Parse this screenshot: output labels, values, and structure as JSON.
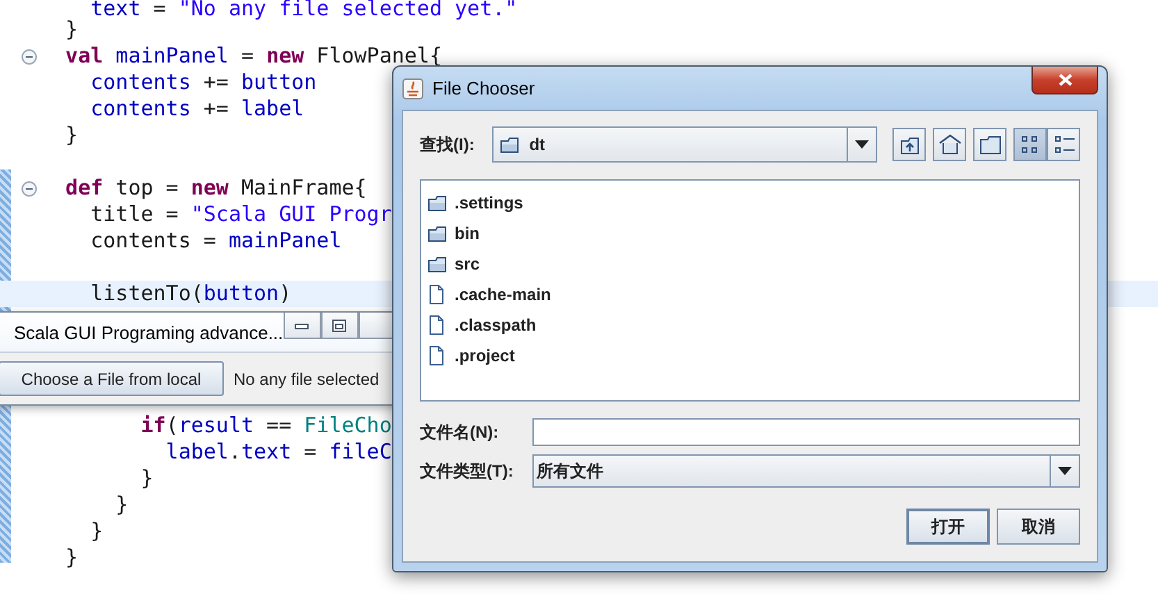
{
  "editor": {
    "lines": [
      {
        "kind": "code",
        "collapsible": false,
        "highlighted": false,
        "tokens": [
          {
            "kind": "field",
            "t": "    text"
          },
          {
            "kind": "plain",
            "t": " = "
          },
          {
            "kind": "string",
            "t": "\"No any file selected yet.\""
          }
        ]
      },
      {
        "kind": "code",
        "collapsible": false,
        "highlighted": false,
        "tokens": [
          {
            "kind": "plain",
            "t": "  }"
          }
        ]
      },
      {
        "kind": "code",
        "collapsible": true,
        "highlighted": false,
        "tokens": [
          {
            "kind": "keyword",
            "t": "  val"
          },
          {
            "kind": "field",
            "t": " mainPanel"
          },
          {
            "kind": "plain",
            "t": " = "
          },
          {
            "kind": "keyword",
            "t": "new"
          },
          {
            "kind": "plain",
            "t": " FlowPanel{"
          }
        ]
      },
      {
        "kind": "code",
        "collapsible": false,
        "highlighted": false,
        "tokens": [
          {
            "kind": "field",
            "t": "    contents"
          },
          {
            "kind": "plain",
            "t": " += "
          },
          {
            "kind": "field",
            "t": "button"
          }
        ]
      },
      {
        "kind": "code",
        "collapsible": false,
        "highlighted": false,
        "tokens": [
          {
            "kind": "field",
            "t": "    contents"
          },
          {
            "kind": "plain",
            "t": " += "
          },
          {
            "kind": "field",
            "t": "label"
          }
        ]
      },
      {
        "kind": "code",
        "collapsible": false,
        "highlighted": false,
        "tokens": [
          {
            "kind": "plain",
            "t": "  }"
          }
        ]
      },
      {
        "kind": "blank"
      },
      {
        "kind": "code",
        "collapsible": true,
        "highlighted": false,
        "tokens": [
          {
            "kind": "keyword",
            "t": "  def"
          },
          {
            "kind": "plain",
            "t": " top = "
          },
          {
            "kind": "keyword",
            "t": "new"
          },
          {
            "kind": "plain",
            "t": " MainFrame{"
          }
        ]
      },
      {
        "kind": "code",
        "collapsible": false,
        "highlighted": false,
        "tokens": [
          {
            "kind": "plain",
            "t": "    title = "
          },
          {
            "kind": "string",
            "t": "\"Scala GUI Progr"
          }
        ]
      },
      {
        "kind": "code",
        "collapsible": false,
        "highlighted": false,
        "tokens": [
          {
            "kind": "plain",
            "t": "    contents = "
          },
          {
            "kind": "field",
            "t": "mainPanel"
          }
        ]
      },
      {
        "kind": "blank"
      },
      {
        "kind": "code",
        "collapsible": false,
        "highlighted": true,
        "tokens": [
          {
            "kind": "plain",
            "t": "    listenTo("
          },
          {
            "kind": "field",
            "t": "button"
          },
          {
            "kind": "plain",
            "t": ")"
          }
        ]
      },
      {
        "kind": "blank"
      },
      {
        "kind": "blank"
      },
      {
        "kind": "blank"
      },
      {
        "kind": "blank"
      },
      {
        "kind": "code",
        "collapsible": false,
        "highlighted": false,
        "tokens": [
          {
            "kind": "keyword",
            "t": "        if"
          },
          {
            "kind": "plain",
            "t": "("
          },
          {
            "kind": "field",
            "t": "result"
          },
          {
            "kind": "plain",
            "t": " == "
          },
          {
            "kind": "type",
            "t": "FileCho"
          }
        ]
      },
      {
        "kind": "code",
        "collapsible": false,
        "highlighted": false,
        "tokens": [
          {
            "kind": "field",
            "t": "          label"
          },
          {
            "kind": "plain",
            "t": "."
          },
          {
            "kind": "field",
            "t": "text"
          },
          {
            "kind": "plain",
            "t": " = "
          },
          {
            "kind": "field",
            "t": "fileC"
          }
        ]
      },
      {
        "kind": "code",
        "collapsible": false,
        "highlighted": false,
        "tokens": [
          {
            "kind": "plain",
            "t": "        }"
          }
        ]
      },
      {
        "kind": "code",
        "collapsible": false,
        "highlighted": false,
        "tokens": [
          {
            "kind": "plain",
            "t": "      }"
          }
        ]
      },
      {
        "kind": "code",
        "collapsible": false,
        "highlighted": false,
        "tokens": [
          {
            "kind": "plain",
            "t": "    }"
          }
        ]
      },
      {
        "kind": "code",
        "collapsible": false,
        "highlighted": false,
        "tokens": [
          {
            "kind": "plain",
            "t": "  }"
          }
        ]
      }
    ]
  },
  "app_window": {
    "title": "Scala GUI Programing advance...",
    "button": "Choose a File from local",
    "label": "No any file selected"
  },
  "file_chooser": {
    "title": "File Chooser",
    "look_in_label": "查找(I):",
    "look_in_value": "dt",
    "toolbar": [
      {
        "kind": "up",
        "selected": false
      },
      {
        "kind": "home",
        "selected": false
      },
      {
        "kind": "new-folder",
        "selected": false
      },
      {
        "kind": "list",
        "selected": true
      },
      {
        "kind": "details",
        "selected": false
      }
    ],
    "files": [
      {
        "kind": "folder",
        "name": ".settings"
      },
      {
        "kind": "folder",
        "name": "bin"
      },
      {
        "kind": "folder",
        "name": "src"
      },
      {
        "kind": "file",
        "name": ".cache-main"
      },
      {
        "kind": "file",
        "name": ".classpath"
      },
      {
        "kind": "file",
        "name": ".project"
      }
    ],
    "file_name_label": "文件名(N):",
    "file_type_label": "文件类型(T):",
    "file_type_value": "所有文件",
    "buttons": [
      {
        "label": "打开",
        "default": true
      },
      {
        "label": "取消",
        "default": false
      }
    ]
  }
}
